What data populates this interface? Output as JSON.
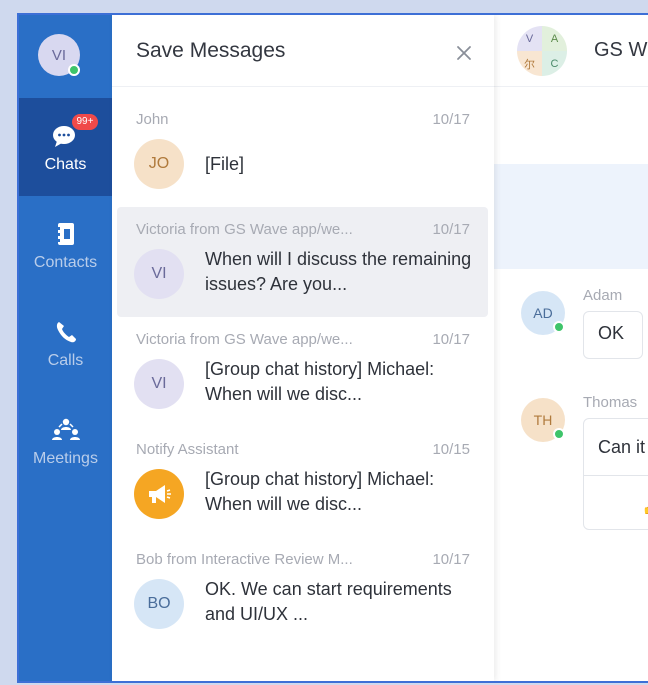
{
  "user": {
    "avatar_initials": "VI"
  },
  "sidebar": {
    "items": [
      {
        "label": "Chats",
        "badge": "99+"
      },
      {
        "label": "Contacts"
      },
      {
        "label": "Calls"
      },
      {
        "label": "Meetings"
      }
    ]
  },
  "panel": {
    "title": "Save Messages",
    "messages": [
      {
        "sender": "John",
        "date": "10/17",
        "initials": "JO",
        "text": "[File]"
      },
      {
        "sender": "Victoria from GS Wave app/we...",
        "date": "10/17",
        "initials": "VI",
        "text": "When will I discuss the remaining issues? Are you..."
      },
      {
        "sender": "Victoria from GS Wave app/we...",
        "date": "10/17",
        "initials": "VI",
        "text": "[Group chat history] Michael: When will we disc..."
      },
      {
        "sender": "Notify Assistant",
        "date": "10/15",
        "initials": "",
        "text": "[Group chat history] Michael: When will we disc..."
      },
      {
        "sender": "Bob from Interactive Review M...",
        "date": "10/17",
        "initials": "BO",
        "text": "OK. We can start requirements and UI/UX ..."
      }
    ]
  },
  "chat": {
    "group_avatar": [
      "V",
      "A",
      "尔",
      "C"
    ],
    "title": "GS W",
    "messages": [
      {
        "name": "Adam",
        "initials": "AD",
        "text": "OK"
      },
      {
        "name": "Thomas",
        "initials": "TH",
        "text": "Can it"
      }
    ]
  },
  "colors": {
    "sidebar_bg": "#2a6fc6",
    "sidebar_active": "#1d4e9c",
    "badge": "#f04a4a",
    "online": "#3ec46a",
    "notify_orange": "#f5a623"
  }
}
